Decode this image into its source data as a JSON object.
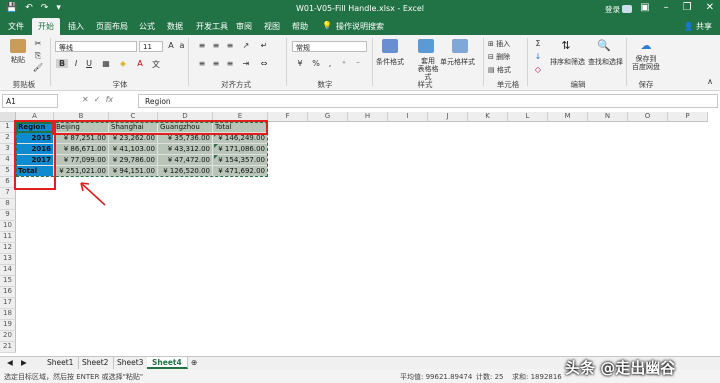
{
  "window": {
    "title": "W01-V05-Fill Handle.xlsx  -  Excel",
    "signin": "登录"
  },
  "tabs": [
    "文件",
    "开始",
    "插入",
    "页面布局",
    "公式",
    "数据",
    "开发工具",
    "审阅",
    "视图",
    "帮助"
  ],
  "tab_search": "操作说明搜索",
  "share": "共享",
  "ribbon": {
    "paste": "粘贴",
    "clipboard": "剪贴板",
    "font_name": "等线",
    "font_size": "11",
    "font_group": "字体",
    "align_group": "对齐方式",
    "number_format": "常规",
    "number_group": "数字",
    "cond_format": "条件格式",
    "table_format": "套用\n表格格式",
    "cell_styles": "单元格样式",
    "styles_group": "样式",
    "insert": "插入",
    "delete": "删除",
    "format": "格式",
    "cells_group": "单元格",
    "sort_filter": "排序和筛选",
    "find_select": "查找和选择",
    "edit_group": "编辑",
    "save_to": "保存到\n百度网盘",
    "save_group": "保存"
  },
  "formula": {
    "name_box": "A1",
    "value": "Region"
  },
  "columns": [
    "A",
    "B",
    "C",
    "D",
    "E",
    "F",
    "G",
    "H",
    "I",
    "J",
    "K",
    "L",
    "M",
    "N",
    "O",
    "P"
  ],
  "rows": [
    "1",
    "2",
    "3",
    "4",
    "5",
    "6",
    "7",
    "8",
    "9",
    "10",
    "11",
    "12",
    "13",
    "14",
    "15",
    "16",
    "17",
    "18",
    "19",
    "20",
    "21"
  ],
  "table": {
    "header": [
      "Region",
      "Beijing",
      "Shanghai",
      "Guangzhou",
      "Total"
    ],
    "body": [
      [
        "2015",
        "¥   87,251.00",
        "¥  23,262.00",
        "¥   35,736.00",
        "¥  146,249.00"
      ],
      [
        "2016",
        "¥   86,671.00",
        "¥  41,103.00",
        "¥   43,312.00",
        "¥  171,086.00"
      ],
      [
        "2017",
        "¥   77,099.00",
        "¥  29,786.00",
        "¥   47,472.00",
        "¥  154,357.00"
      ],
      [
        "Total",
        "¥  251,021.00",
        "¥  94,151.00",
        "¥  126,520.00",
        "¥  471,692.00"
      ]
    ]
  },
  "sheets": [
    "Sheet1",
    "Sheet2",
    "Sheet3",
    "Sheet4"
  ],
  "active_sheet": "Sheet4",
  "status": {
    "left": "选定目标区域，然后按 ENTER 或选择\"粘贴\"",
    "avg": "平均值: 99621.89474",
    "count": "计数: 25",
    "sum": "求和: 1892816"
  },
  "watermark": "头条 @走出幽谷",
  "colors": {
    "excel_green": "#217346",
    "header_fill": "#0e8bd0",
    "body_fill": "#b9c5b8",
    "annotation": "#e0201c"
  }
}
